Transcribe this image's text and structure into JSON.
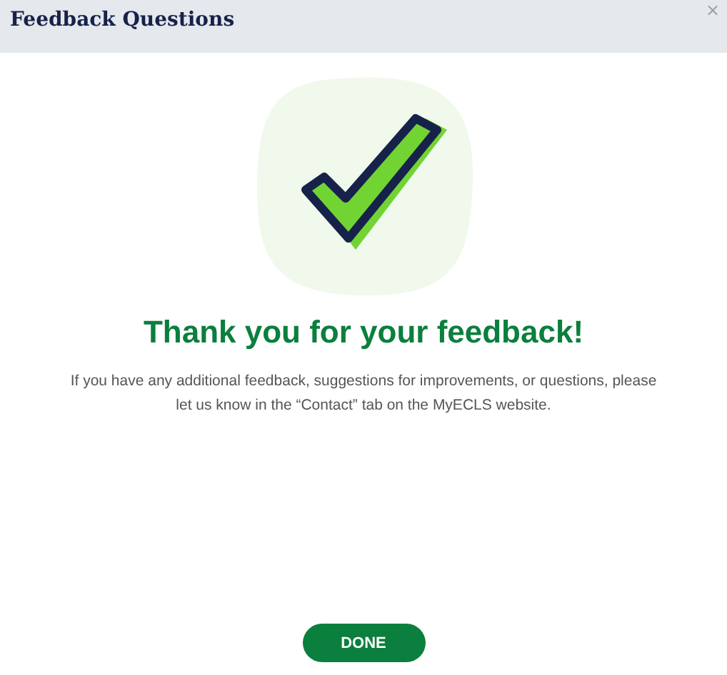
{
  "window": {
    "title": "Feedback Questions",
    "close": "×"
  },
  "message": {
    "heading": "Thank you for your feedback!",
    "body": "If you have any additional feedback, suggestions for improvements, or questions, please let us know in the “Contact” tab on the MyECLS website."
  },
  "buttons": [
    {
      "label": "DONE",
      "kind": "primary"
    }
  ]
}
